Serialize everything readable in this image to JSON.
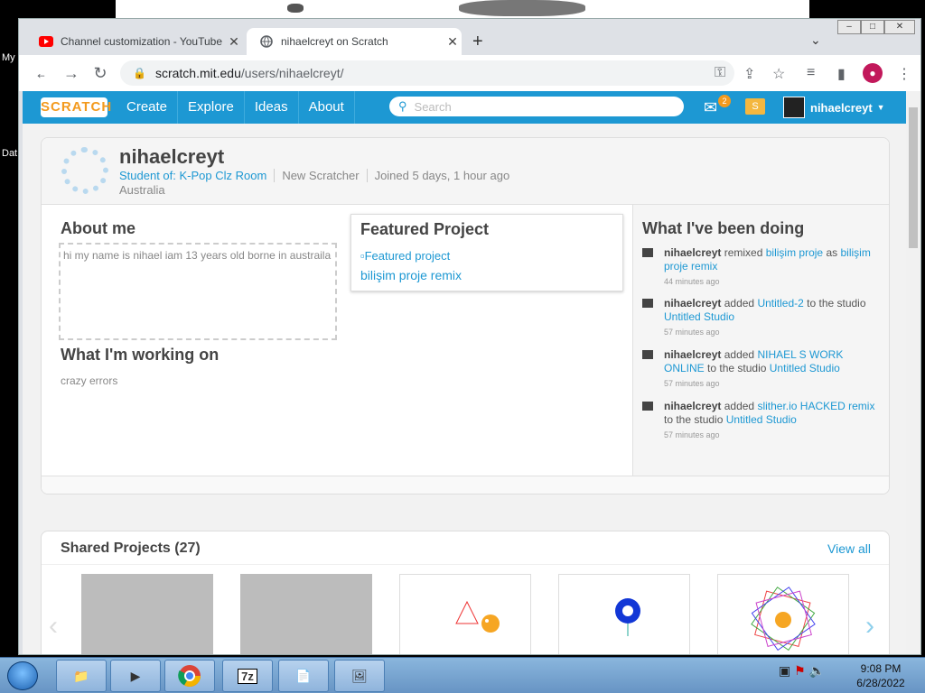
{
  "desktop": {
    "icons": [
      "My",
      "Dat"
    ]
  },
  "browser": {
    "tabs": [
      {
        "title": "Channel customization - YouTube",
        "active": false,
        "favicon": "youtube-icon"
      },
      {
        "title": "nihaelcreyt on Scratch",
        "active": true,
        "favicon": "globe-icon"
      }
    ],
    "url_host": "scratch.mit.edu",
    "url_path": "/users/nihaelcreyt/",
    "window_buttons": [
      "–",
      "□",
      "✕"
    ]
  },
  "scratch": {
    "logo": "SCRATCH",
    "nav": [
      "Create",
      "Explore",
      "Ideas",
      "About"
    ],
    "search_placeholder": "Search",
    "messages_count": "2",
    "username": "nihaelcreyt",
    "profile": {
      "name": "nihaelcreyt",
      "student_of_label": "Student of: K-Pop Clz Room",
      "status": "New Scratcher",
      "joined": "Joined 5 days, 1 hour ago",
      "country": "Australia"
    },
    "about_me_title": "About me",
    "about_me_text": "hi my name is nihael iam 13 years old borne in austraila",
    "working_on_title": "What I'm working on",
    "working_on_text": "crazy errors",
    "featured_title": "Featured Project",
    "featured_img_alt": "Featured project",
    "featured_link": "bilişim proje remix",
    "activity_title": "What I've been doing",
    "activity": [
      {
        "user": "nihaelcreyt",
        "verb": "remixed",
        "item": "bilişim proje",
        "mid": "as",
        "target": "bilişim proje remix",
        "time": "44 minutes ago"
      },
      {
        "user": "nihaelcreyt",
        "verb": "added",
        "item": "Untitled-2",
        "mid": "to the studio",
        "target": "Untitled Studio",
        "time": "57 minutes ago"
      },
      {
        "user": "nihaelcreyt",
        "verb": "added",
        "item": "NIHAEL S WORK ONLINE",
        "mid": "to the studio",
        "target": "Untitled Studio",
        "time": "57 minutes ago"
      },
      {
        "user": "nihaelcreyt",
        "verb": "added",
        "item": "slither.io HACKED remix",
        "mid": "to the studio",
        "target": "Untitled Studio",
        "time": "57 minutes ago"
      }
    ],
    "shared_title": "Shared Projects (27)",
    "view_all": "View all"
  },
  "taskbar": {
    "time": "9:08 PM",
    "date": "6/28/2022"
  }
}
